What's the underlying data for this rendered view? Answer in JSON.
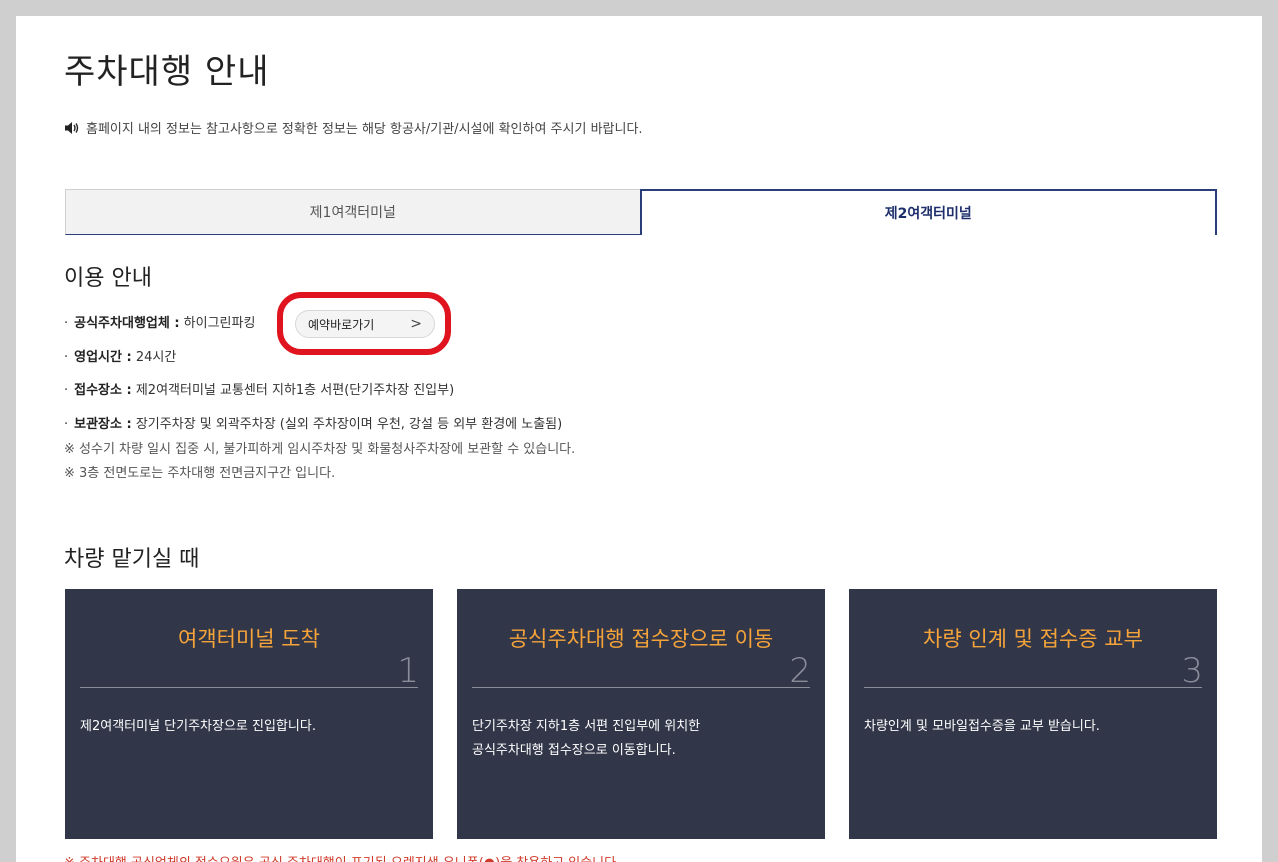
{
  "page": {
    "title": "주차대행 안내",
    "notice": "홈페이지 내의 정보는 참고사항으로 정확한 정보는 해당 항공사/기관/시설에 확인하여 주시기 바랍니다."
  },
  "tabs": [
    {
      "label": "제1여객터미널",
      "active": false
    },
    {
      "label": "제2여객터미널",
      "active": true
    }
  ],
  "usage": {
    "title": "이용 안내",
    "items": [
      {
        "bullet": "·",
        "label": "공식주차대행업체 :",
        "value": " 하이그린파킹"
      },
      {
        "bullet": "·",
        "label": "영업시간 :",
        "value": " 24시간"
      },
      {
        "bullet": "·",
        "label": "접수장소 :",
        "value": " 제2여객터미널 교통센터 지하1층 서편(단기주차장 진입부)"
      },
      {
        "bullet": "·",
        "label": "보관장소 :",
        "value": " 장기주차장 및 외곽주차장 (실외 주차장이며 우천, 강설 등 외부 환경에 노출됨)"
      }
    ],
    "notes": [
      "※ 성수기 차량 일시 집중 시, 불가피하게 임시주차장 및 화물청사주차장에 보관할 수 있습니다.",
      "※ 3층 전면도로는 주차대행 전면금지구간 입니다."
    ],
    "reserve_button": "예약바로가기",
    "reserve_chevron": ">"
  },
  "dropoff": {
    "title": "차량 맡기실 때",
    "steps": [
      {
        "title": "여객터미널 도착",
        "num": "1",
        "desc": [
          "제2여객터미널 단기주차장으로 진입합니다."
        ]
      },
      {
        "title": "공식주차대행 접수장으로 이동",
        "num": "2",
        "desc": [
          "단기주차장 지하1층 서편 진입부에 위치한",
          "공식주차대행 접수장으로 이동합니다."
        ]
      },
      {
        "title": "차량 인계 및 접수증 교부",
        "num": "3",
        "desc": [
          "차량인계 및 모바일접수증을 교부 받습니다."
        ]
      }
    ],
    "footer": "※ 주차대행 공식업체의 접수요원은 공식 주차대행이 표기된 오렌지색 유니폼(●)을 착용하고 있습니다."
  },
  "colors": {
    "accent": "#2c3e7a",
    "card_bg": "#323649",
    "step_title": "#f6a43a",
    "highlight": "#e0141e"
  }
}
